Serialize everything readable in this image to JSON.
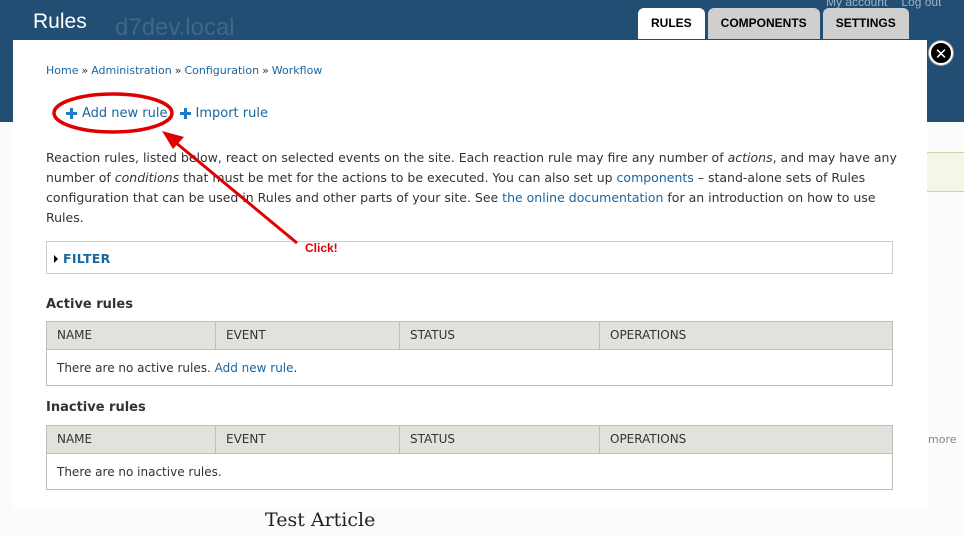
{
  "background": {
    "title": "Rules",
    "site_name": "d7dev.local",
    "account_links": [
      "My account",
      "Log out"
    ],
    "tabs": [
      {
        "label": "RULES",
        "active": true
      },
      {
        "label": "COMPONENTS",
        "active": false
      },
      {
        "label": "SETTINGS",
        "active": false
      }
    ],
    "more_text": "more",
    "article_title": "Test Article"
  },
  "dialog": {
    "close_symbol": "✕",
    "breadcrumb": [
      "Home",
      "Administration",
      "Configuration",
      "Workflow"
    ],
    "breadcrumb_separator": "»",
    "actions": {
      "add_label": "Add new rule",
      "import_label": "Import rule"
    },
    "description": {
      "p1": "Reaction rules, listed below, react on selected events on the site. Each reaction rule may fire any number of ",
      "em1": "actions",
      "p2": ", and may have any number of ",
      "em2": "conditions",
      "p3": " that must be met for the actions to be executed. You can also set up ",
      "link1": "components",
      "p4": " – stand-alone sets of Rules configuration that can be used in Rules and other parts of your site. See ",
      "link2": "the online documentation",
      "p5": " for an introduction on how to use Rules."
    },
    "filter_label": "FILTER",
    "columns": [
      "NAME",
      "EVENT",
      "STATUS",
      "OPERATIONS"
    ],
    "active": {
      "title": "Active rules",
      "empty_text": "There are no active rules. ",
      "empty_link": "Add new rule",
      "empty_suffix": "."
    },
    "inactive": {
      "title": "Inactive rules",
      "empty_text": "There are no inactive rules."
    }
  },
  "annotation": {
    "label": "Click!",
    "color": "#e00000"
  }
}
